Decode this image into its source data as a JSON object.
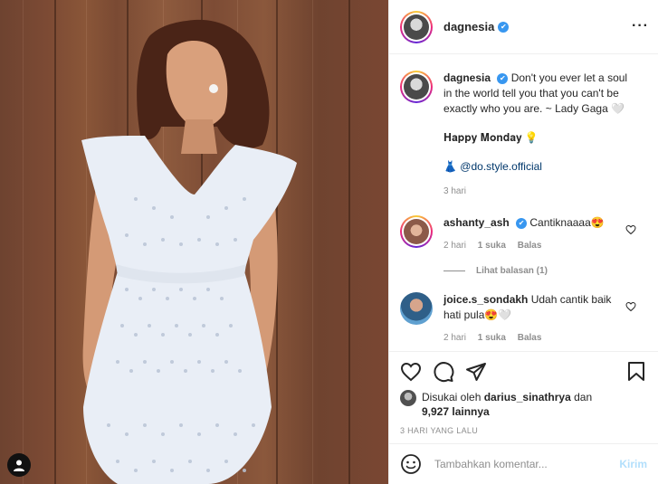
{
  "post": {
    "username": "dagnesia",
    "verified_mark": "✔"
  },
  "caption": {
    "username": "dagnesia",
    "text": "Don't you ever let a soul in the world tell you that you can't be exactly who you are. ~ Lady Gaga 🤍",
    "line2": "𝐇𝐚𝐩𝐩𝐲 𝐌𝐨𝐧𝐝𝐚𝐲 💡",
    "line3_icon": "👗",
    "line3_tag": "@do.style.official",
    "time": "3 hari"
  },
  "comments": [
    {
      "username": "ashanty_ash",
      "text": "Cantiknaaaa😍",
      "time": "2 hari",
      "likes": "1 suka",
      "reply": "Balas",
      "view_replies": "Lihat balasan (1)"
    },
    {
      "username": "joice.s_sondakh",
      "text": "Udah cantik baik hati pula😍🤍",
      "time": "2 hari",
      "likes": "1 suka",
      "reply": "Balas"
    }
  ],
  "likes": {
    "prefix": "Disukai oleh",
    "user": "darius_sinathrya",
    "middle": "dan",
    "count": "9,927 lainnya"
  },
  "timestamp": "3 HARI YANG LALU",
  "add_comment": {
    "placeholder": "Tambahkan komentar...",
    "post_label": "Kirim"
  },
  "icons": {
    "more": "more-horizontal-icon",
    "heart": "heart-icon",
    "comment": "comment-icon",
    "share": "share-icon",
    "save": "bookmark-icon",
    "emoji": "emoji-icon",
    "user_tag": "user-tag-icon"
  },
  "colors": {
    "verified": "#3897f0",
    "link": "#00376b",
    "muted": "#8e8e8e",
    "post_button": "#b2dffc"
  }
}
